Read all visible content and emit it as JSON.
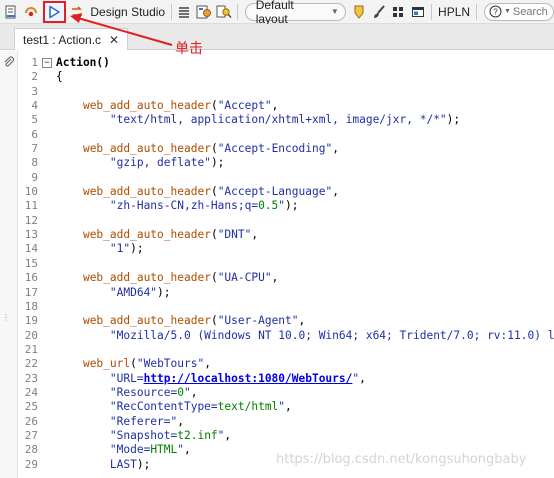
{
  "toolbar": {
    "design_studio_label": "Design Studio",
    "layout_dropdown_value": "Default layout",
    "hpln_label": "HPLN",
    "search_placeholder": "Search"
  },
  "tab": {
    "title": "test1 : Action.c",
    "close_glyph": "✕"
  },
  "annotation": {
    "label": "单击",
    "color": "#e02020"
  },
  "editor": {
    "lines": [
      {
        "n": "1",
        "fold": "−",
        "indent": "",
        "segs": [
          {
            "t": "Action()",
            "c": "bold"
          }
        ]
      },
      {
        "n": "2",
        "fold": "",
        "indent": "",
        "segs": [
          {
            "t": "{",
            "c": ""
          }
        ]
      },
      {
        "n": "3",
        "fold": "",
        "indent": "",
        "segs": []
      },
      {
        "n": "4",
        "fold": "",
        "indent": "    ",
        "segs": [
          {
            "t": "web_add_auto_header",
            "c": "fn"
          },
          {
            "t": "(",
            "c": ""
          },
          {
            "t": "\"Accept\"",
            "c": "str"
          },
          {
            "t": ",",
            "c": ""
          }
        ]
      },
      {
        "n": "5",
        "fold": "",
        "indent": "        ",
        "segs": [
          {
            "t": "\"text/html, application/xhtml+xml, image/jxr, */*\"",
            "c": "str"
          },
          {
            "t": ");",
            "c": ""
          }
        ]
      },
      {
        "n": "6",
        "fold": "",
        "indent": "",
        "segs": []
      },
      {
        "n": "7",
        "fold": "",
        "indent": "    ",
        "segs": [
          {
            "t": "web_add_auto_header",
            "c": "fn"
          },
          {
            "t": "(",
            "c": ""
          },
          {
            "t": "\"Accept-Encoding\"",
            "c": "str"
          },
          {
            "t": ",",
            "c": ""
          }
        ]
      },
      {
        "n": "8",
        "fold": "",
        "indent": "        ",
        "segs": [
          {
            "t": "\"gzip, deflate\"",
            "c": "str"
          },
          {
            "t": ");",
            "c": ""
          }
        ]
      },
      {
        "n": "9",
        "fold": "",
        "indent": "",
        "segs": []
      },
      {
        "n": "10",
        "fold": "",
        "indent": "    ",
        "segs": [
          {
            "t": "web_add_auto_header",
            "c": "fn"
          },
          {
            "t": "(",
            "c": ""
          },
          {
            "t": "\"Accept-Language\"",
            "c": "str"
          },
          {
            "t": ",",
            "c": ""
          }
        ]
      },
      {
        "n": "11",
        "fold": "",
        "indent": "        ",
        "segs": [
          {
            "t": "\"zh-Hans-CN,zh-Hans;q=",
            "c": "str"
          },
          {
            "t": "0.5",
            "c": "kw"
          },
          {
            "t": "\"",
            "c": "str"
          },
          {
            "t": ");",
            "c": ""
          }
        ]
      },
      {
        "n": "12",
        "fold": "",
        "indent": "",
        "segs": []
      },
      {
        "n": "13",
        "fold": "",
        "indent": "    ",
        "segs": [
          {
            "t": "web_add_auto_header",
            "c": "fn"
          },
          {
            "t": "(",
            "c": ""
          },
          {
            "t": "\"DNT\"",
            "c": "str"
          },
          {
            "t": ",",
            "c": ""
          }
        ]
      },
      {
        "n": "14",
        "fold": "",
        "indent": "        ",
        "segs": [
          {
            "t": "\"1\"",
            "c": "str"
          },
          {
            "t": ");",
            "c": ""
          }
        ]
      },
      {
        "n": "15",
        "fold": "",
        "indent": "",
        "segs": []
      },
      {
        "n": "16",
        "fold": "",
        "indent": "    ",
        "segs": [
          {
            "t": "web_add_auto_header",
            "c": "fn"
          },
          {
            "t": "(",
            "c": ""
          },
          {
            "t": "\"UA-CPU\"",
            "c": "str"
          },
          {
            "t": ",",
            "c": ""
          }
        ]
      },
      {
        "n": "17",
        "fold": "",
        "indent": "        ",
        "segs": [
          {
            "t": "\"AMD64\"",
            "c": "str"
          },
          {
            "t": ");",
            "c": ""
          }
        ]
      },
      {
        "n": "18",
        "fold": "",
        "indent": "",
        "segs": []
      },
      {
        "n": "19",
        "fold": "",
        "indent": "    ",
        "segs": [
          {
            "t": "web_add_auto_header",
            "c": "fn"
          },
          {
            "t": "(",
            "c": ""
          },
          {
            "t": "\"User-Agent\"",
            "c": "str"
          },
          {
            "t": ",",
            "c": ""
          }
        ]
      },
      {
        "n": "20",
        "fold": "",
        "indent": "        ",
        "segs": [
          {
            "t": "\"Mozilla/5.0 (Windows NT 10.0; Win64; x64; Trident/7.0; rv:11.0) l",
            "c": "str"
          }
        ]
      },
      {
        "n": "21",
        "fold": "",
        "indent": "",
        "segs": []
      },
      {
        "n": "22",
        "fold": "",
        "indent": "    ",
        "segs": [
          {
            "t": "web_url",
            "c": "fn"
          },
          {
            "t": "(",
            "c": ""
          },
          {
            "t": "\"WebTours\"",
            "c": "str"
          },
          {
            "t": ",",
            "c": ""
          }
        ]
      },
      {
        "n": "23",
        "fold": "",
        "indent": "        ",
        "segs": [
          {
            "t": "\"URL=",
            "c": "str"
          },
          {
            "t": "http://localhost:1080/WebTours/",
            "c": "url"
          },
          {
            "t": "\"",
            "c": "str"
          },
          {
            "t": ",",
            "c": ""
          }
        ]
      },
      {
        "n": "24",
        "fold": "",
        "indent": "        ",
        "segs": [
          {
            "t": "\"Resource=",
            "c": "str"
          },
          {
            "t": "0",
            "c": "kw"
          },
          {
            "t": "\"",
            "c": "str"
          },
          {
            "t": ",",
            "c": ""
          }
        ]
      },
      {
        "n": "25",
        "fold": "",
        "indent": "        ",
        "segs": [
          {
            "t": "\"RecContentType=",
            "c": "str"
          },
          {
            "t": "text/html",
            "c": "kw"
          },
          {
            "t": "\"",
            "c": "str"
          },
          {
            "t": ",",
            "c": ""
          }
        ]
      },
      {
        "n": "26",
        "fold": "",
        "indent": "        ",
        "segs": [
          {
            "t": "\"Referer=\"",
            "c": "str"
          },
          {
            "t": ",",
            "c": ""
          }
        ]
      },
      {
        "n": "27",
        "fold": "",
        "indent": "        ",
        "segs": [
          {
            "t": "\"Snapshot=",
            "c": "str"
          },
          {
            "t": "t2.inf",
            "c": "kw"
          },
          {
            "t": "\"",
            "c": "str"
          },
          {
            "t": ",",
            "c": ""
          }
        ]
      },
      {
        "n": "28",
        "fold": "",
        "indent": "        ",
        "segs": [
          {
            "t": "\"Mode=",
            "c": "str"
          },
          {
            "t": "HTML",
            "c": "kw"
          },
          {
            "t": "\"",
            "c": "str"
          },
          {
            "t": ",",
            "c": ""
          }
        ]
      },
      {
        "n": "29",
        "fold": "",
        "indent": "        ",
        "segs": [
          {
            "t": "LAST",
            "c": "str"
          },
          {
            "t": ");",
            "c": ""
          }
        ]
      }
    ]
  },
  "watermark": "https://blog.csdn.net/kongsuhongbaby"
}
